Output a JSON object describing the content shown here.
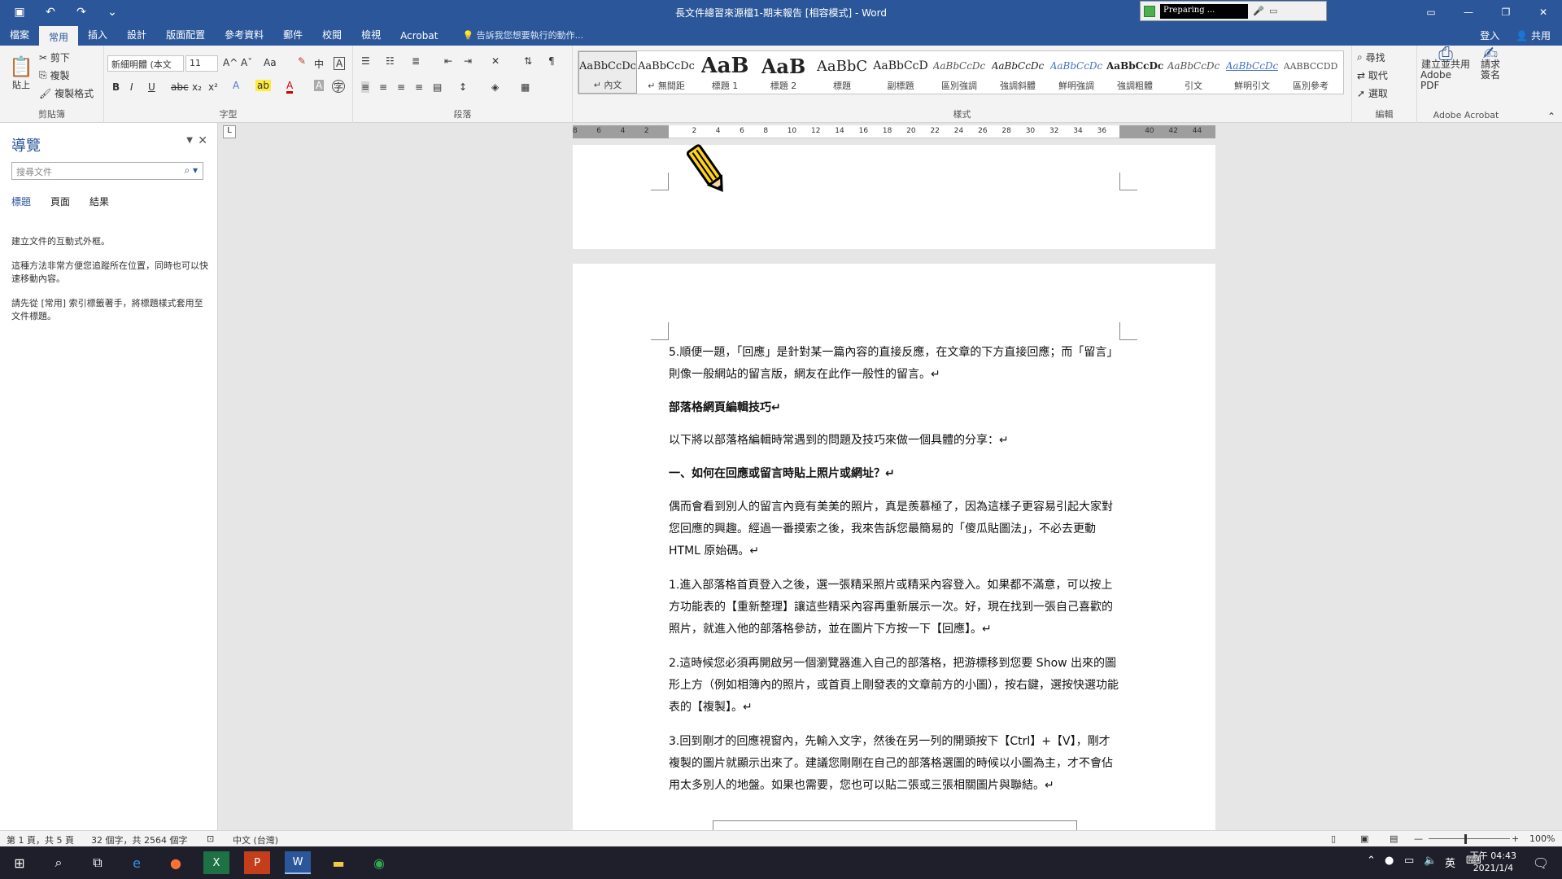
{
  "window": {
    "title": "長文件總習來源檔1-期末報告 [相容模式] - Word"
  },
  "recorder": {
    "status": "Preparing ..."
  },
  "tabs": [
    "檔案",
    "常用",
    "插入",
    "設計",
    "版面配置",
    "參考資料",
    "郵件",
    "校閱",
    "檢視",
    "Acrobat"
  ],
  "active_tab": "常用",
  "tell_me": "告訴我您想要執行的動作...",
  "account": {
    "signin": "登入",
    "share": "共用"
  },
  "clipboard": {
    "paste": "貼上",
    "cut": "剪下",
    "copy": "複製",
    "format_painter": "複製格式",
    "label": "剪貼簿"
  },
  "font": {
    "name": "新細明體 (本文",
    "size": "11",
    "label": "字型",
    "bold": "B",
    "italic": "I",
    "underline": "U",
    "strike": "abc",
    "sub": "x₂",
    "sup": "x²",
    "grow": "A^",
    "shrink": "Aˇ",
    "case": "Aa"
  },
  "paragraph": {
    "label": "段落"
  },
  "styles": {
    "label": "樣式",
    "items": [
      {
        "preview": "AaBbCcDc",
        "name": "↵ 內文"
      },
      {
        "preview": "AaBbCcDc",
        "name": "↵ 無間距"
      },
      {
        "preview": "AaB",
        "name": "標題 1"
      },
      {
        "preview": "AaB",
        "name": "標題 2"
      },
      {
        "preview": "AaBbC",
        "name": "標題"
      },
      {
        "preview": "AaBbCcD",
        "name": "副標題"
      },
      {
        "preview": "AaBbCcDc",
        "name": "區別強調"
      },
      {
        "preview": "AaBbCcDc",
        "name": "強調斜體"
      },
      {
        "preview": "AaBbCcDc",
        "name": "鮮明強調"
      },
      {
        "preview": "AaBbCcDc",
        "name": "強調粗體"
      },
      {
        "preview": "AaBbCcDc",
        "name": "引文"
      },
      {
        "preview": "AaBbCcDc",
        "name": "鮮明引文"
      },
      {
        "preview": "AABBCCDD",
        "name": "區別參考"
      }
    ]
  },
  "editing": {
    "find": "尋找",
    "replace": "取代",
    "select": "選取",
    "label": "編輯"
  },
  "acrobat": {
    "create": "建立並共用",
    "create2": "Adobe PDF",
    "sign": "請求",
    "sign2": "簽名",
    "label": "Adobe Acrobat"
  },
  "nav": {
    "title": "導覽",
    "search_placeholder": "搜尋文件",
    "tabs": [
      "標題",
      "頁面",
      "結果"
    ],
    "msg1": "建立文件的互動式外框。",
    "msg2": "這種方法非常方便您追蹤所在位置，同時也可以快速移動內容。",
    "msg3": "請先從 [常用] 索引標籤著手，將標題樣式套用至文件標題。"
  },
  "ruler": {
    "marks": [
      "8",
      "6",
      "4",
      "2",
      "",
      "2",
      "4",
      "6",
      "8",
      "10",
      "12",
      "14",
      "16",
      "18",
      "20",
      "22",
      "24",
      "26",
      "28",
      "30",
      "32",
      "34",
      "36",
      "",
      "40",
      "42",
      "44"
    ],
    "tab_selector": "L"
  },
  "document": {
    "paragraphs": [
      {
        "text": "5.順便一題，「回應」是針對某一篇內容的直接反應，在文章的下方直接回應；而「留言」則像一般網站的留言版，網友在此作一般性的留言。↵",
        "bold": false
      },
      {
        "text": "部落格網頁編輯技巧↵",
        "bold": true
      },
      {
        "text": "以下將以部落格編輯時常遇到的問題及技巧來做一個具體的分享：↵",
        "bold": false
      },
      {
        "text": "一、如何在回應或留言時貼上照片或網址？↵",
        "bold": true
      },
      {
        "text": "偶而會看到別人的留言內竟有美美的照片，真是羨慕極了，因為這樣子更容易引起大家對您回應的興趣。經過一番摸索之後，我來告訴您最簡易的「傻瓜貼圖法」，不必去更動 HTML 原始碼。↵",
        "bold": false
      },
      {
        "text": "1.進入部落格首頁登入之後，選一張精采照片或精采內容登入。如果都不滿意，可以按上方功能表的【重新整理】讓這些精采內容再重新展示一次。好，現在找到一張自己喜歡的照片，就進入他的部落格參訪，並在圖片下方按一下【回應】。↵",
        "bold": false
      },
      {
        "text": "2.這時候您必須再開啟另一個瀏覽器進入自己的部落格，把游標移到您要 Show 出來的圖形上方（例如相簿內的照片，或首頁上剛發表的文章前方的小圖），按右鍵，選按快選功能表的【複製】。↵",
        "bold": false
      },
      {
        "text": "3.回到剛才的回應視窗內，先輸入文字，然後在另一列的開頭按下【Ctrl】+【V】，剛才複製的圖片就顯示出來了。建議您剛剛在自己的部落格選圖的時候以小圖為主，才不會佔用太多別人的地盤。如果也需要，您也可以貼二張或三張相關圖片與聯結。↵",
        "bold": false
      }
    ]
  },
  "status": {
    "page": "第 1 頁，共 5 頁",
    "words": "32 個字，共 2564 個字",
    "lang": "中文 (台灣)",
    "zoom": "100%"
  },
  "taskbar": {
    "time": "下午 04:43",
    "date": "2021/1/4",
    "ime": "英"
  }
}
